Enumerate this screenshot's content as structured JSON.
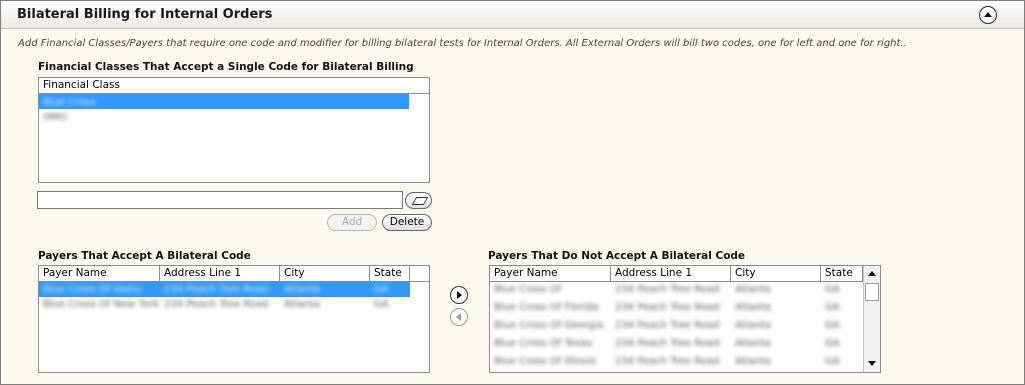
{
  "panel": {
    "title": "Bilateral Billing for Internal Orders",
    "description": "Add Financial Classes/Payers that require one code and modifier for billing bilateral tests for Internal Orders. All External Orders will bill two codes, one for left and one for right.."
  },
  "financial_classes": {
    "section_label": "Financial Classes That Accept a Single Code for Bilateral Billing",
    "column_header": "Financial Class",
    "rows": [
      "Blue Cross",
      "HMO"
    ],
    "selected_index": 0,
    "input_value": "",
    "add_label": "Add",
    "delete_label": "Delete"
  },
  "payers_accept": {
    "section_label": "Payers That Accept A Bilateral Code",
    "columns": [
      "Payer Name",
      "Address Line 1",
      "City",
      "State"
    ],
    "rows": [
      [
        "Blue Cross Of Idaho",
        "234 Peach Tree Road",
        "Atlanta",
        "GA"
      ],
      [
        "Blue Cross Of New York",
        "234 Peach Tree Road",
        "Atlanta",
        "GA"
      ]
    ],
    "selected_index": 0
  },
  "payers_not_accept": {
    "section_label": "Payers That Do Not Accept A Bilateral Code",
    "columns": [
      "Payer Name",
      "Address Line 1",
      "City",
      "State"
    ],
    "rows": [
      [
        "Blue Cross Of",
        "234 Peach Tree Road",
        "Atlanta",
        "GA"
      ],
      [
        "Blue Cross Of Florida",
        "234 Peach Tree Road",
        "Atlanta",
        "GA"
      ],
      [
        "Blue Cross Of Georgia",
        "234 Peach Tree Road",
        "Atlanta",
        "GA"
      ],
      [
        "Blue Cross Of Texas",
        "234 Peach Tree Road",
        "Atlanta",
        "GA"
      ],
      [
        "Blue Cross Of Illinois",
        "234 Peach Tree Road",
        "Atlanta",
        "GA"
      ]
    ]
  },
  "icons": {
    "collapse": "collapse-up-icon",
    "eraser": "eraser-icon",
    "move_right": "arrow-right-icon",
    "move_left": "arrow-left-icon"
  },
  "colors": {
    "selection": "#3399ff",
    "background": "#fcfaf0"
  }
}
